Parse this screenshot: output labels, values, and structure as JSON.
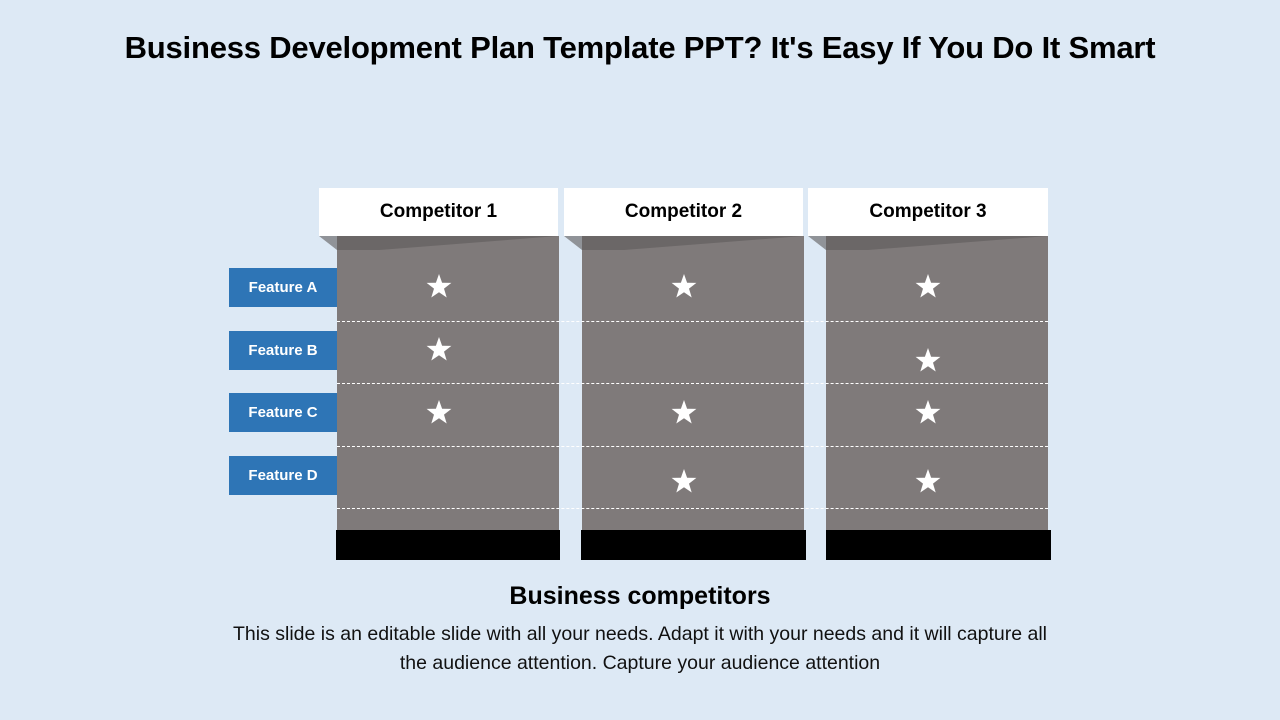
{
  "slide": {
    "title": "Business Development Plan Template PPT? It's Easy If You Do It Smart",
    "subtitle": "Business competitors",
    "description": "This slide is an editable slide with all your needs. Adapt it with your needs and it will capture all the audience attention. Capture your audience attention"
  },
  "colors": {
    "background": "#dde9f5",
    "column": "#7f7a7a",
    "feature_label": "#2e75b6",
    "base": "#000000",
    "header": "#ffffff",
    "star": "#ffffff"
  },
  "competitors": [
    {
      "name": "Competitor 1"
    },
    {
      "name": "Competitor 2"
    },
    {
      "name": "Competitor 3"
    }
  ],
  "features": [
    {
      "label": "Feature A"
    },
    {
      "label": "Feature B"
    },
    {
      "label": "Feature C"
    },
    {
      "label": "Feature D"
    }
  ],
  "matrix": {
    "icon": "star-icon",
    "rows": [
      [
        true,
        true,
        true
      ],
      [
        true,
        false,
        true
      ],
      [
        true,
        true,
        true
      ],
      [
        false,
        true,
        true
      ]
    ]
  }
}
